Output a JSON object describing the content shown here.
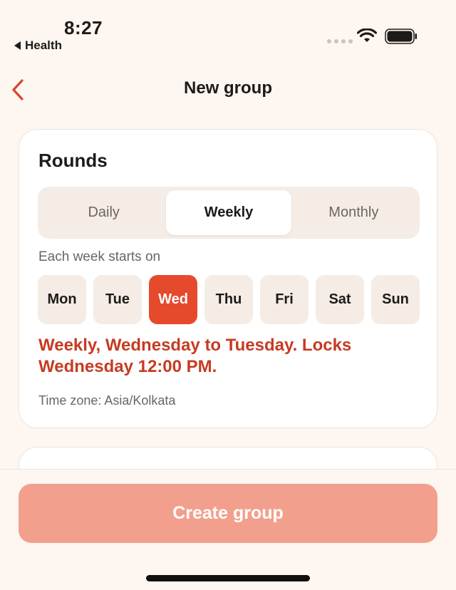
{
  "status_bar": {
    "time": "8:27",
    "back_app": "Health"
  },
  "nav": {
    "title": "New group",
    "back_icon": "chevron-left-icon"
  },
  "rounds": {
    "title": "Rounds",
    "frequency_options": [
      "Daily",
      "Weekly",
      "Monthly"
    ],
    "selected_frequency": "Weekly",
    "week_label": "Each week starts on",
    "days": [
      "Mon",
      "Tue",
      "Wed",
      "Thu",
      "Fri",
      "Sat",
      "Sun"
    ],
    "selected_day": "Wed",
    "summary": "Weekly, Wednesday to Tuesday. Locks Wednesday 12:00 PM.",
    "time_zone": "Time zone: Asia/Kolkata"
  },
  "actions": {
    "create_label": "Create group"
  },
  "colors": {
    "accent": "#e54a2c",
    "summary_text": "#c63b22",
    "create_button_disabled": "#f2a08d",
    "background": "#fdf6f1"
  }
}
